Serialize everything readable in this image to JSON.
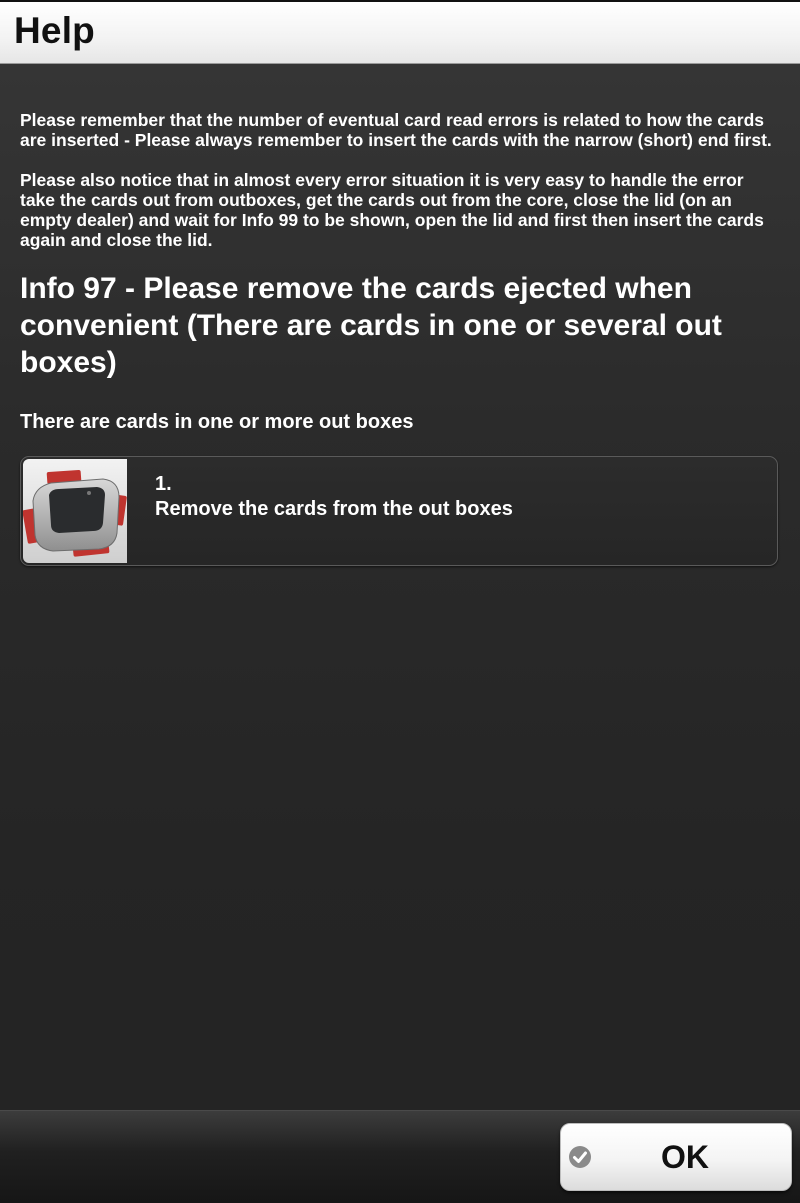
{
  "header": {
    "title": "Help"
  },
  "intro": {
    "paragraph_1": "Please remember that the number of eventual card read errors is related to how the cards are inserted - Please always remember to insert the cards with the narrow (short) end first.",
    "paragraph_2": "Please also notice that in almost every error situation it is very easy to handle the error take the cards out from outboxes, get the cards out from the core, close the lid (on an empty dealer) and wait for Info 99 to be shown, open the lid and first then insert the cards again and close the lid."
  },
  "info": {
    "title": "Info 97 - Please remove the cards ejected when convenient (There are cards in one or several out boxes)",
    "subtitle": "There are cards in one or more out boxes"
  },
  "steps": [
    {
      "number": "1.",
      "text": "Remove the cards from the out boxes",
      "image": "card-dealer-illustration"
    }
  ],
  "footer": {
    "ok_label": "OK",
    "ok_icon": "checkmark-circle-icon"
  }
}
